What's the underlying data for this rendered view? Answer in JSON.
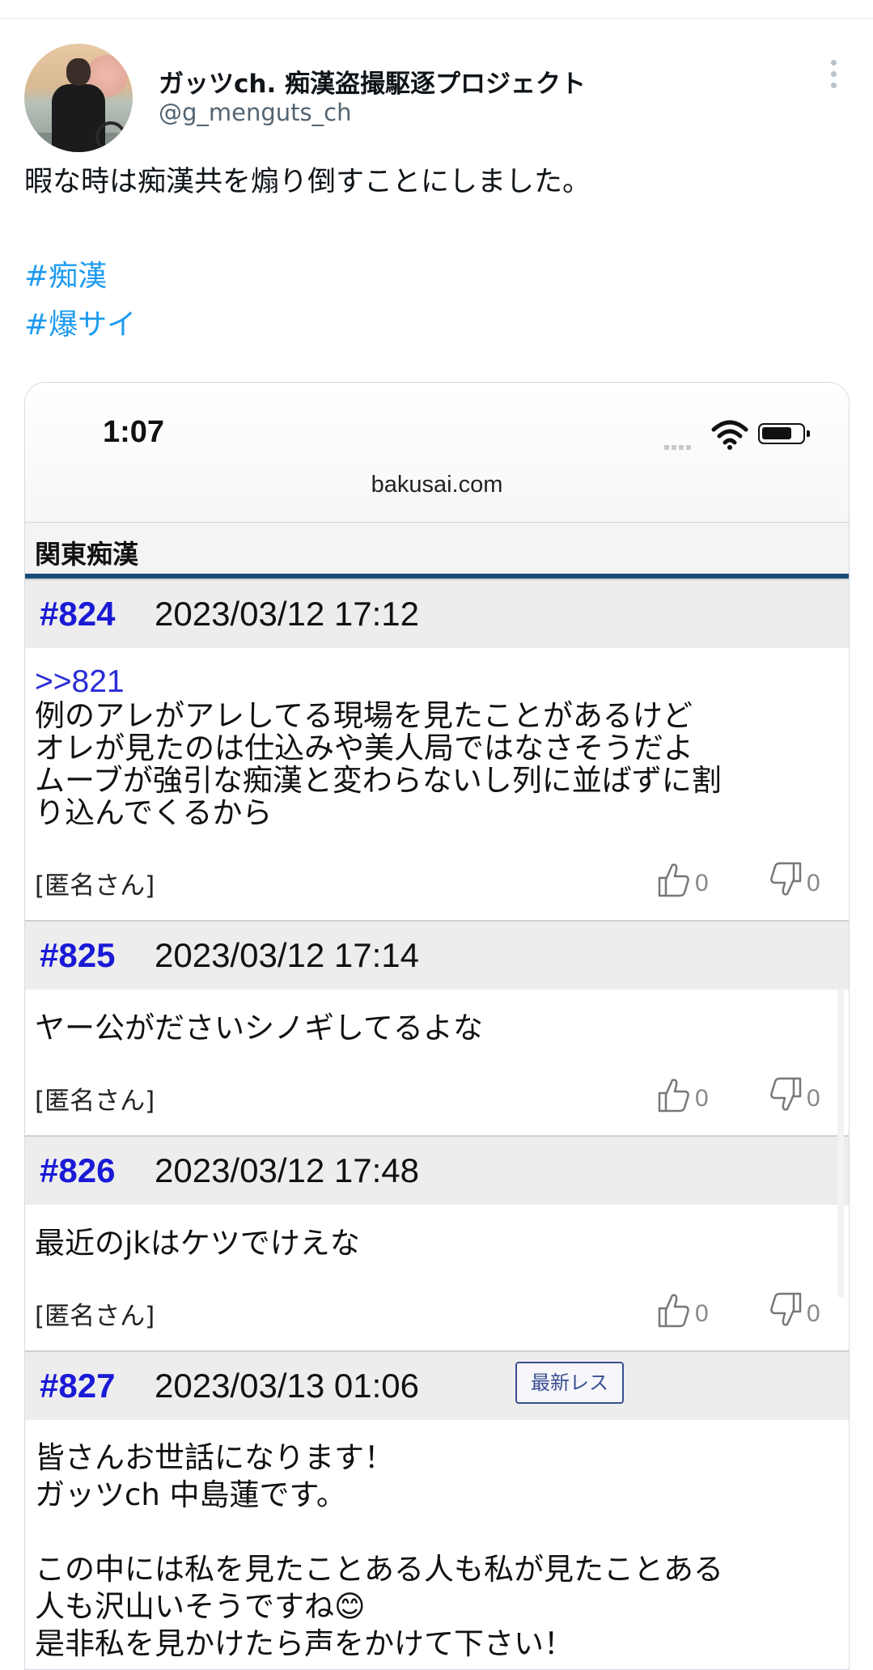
{
  "tweet": {
    "author_name": "ガッツch. 痴漢盗撮駆逐プロジェクト",
    "handle": "@g_menguts_ch",
    "text": "暇な時は痴漢共を煽り倒すことにしました。",
    "hashtags": [
      "#痴漢",
      "#爆サイ"
    ]
  },
  "embedded_screenshot": {
    "status_time": "1:07",
    "domain": "bakusai.com",
    "board_title": "関東痴漢",
    "posts": [
      {
        "number": "#824",
        "date": "2023/03/12 17:12",
        "reply_to": ">>821",
        "body": "例のアレがアレしてる現場を見たことがあるけど\nオレが見たのは仕込みや美人局ではなさそうだよ\nムーブが強引な痴漢と変わらないし列に並ばずに割\nり込んでくるから",
        "author": "[匿名さん]",
        "likes": "0",
        "dislikes": "0"
      },
      {
        "number": "#825",
        "date": "2023/03/12 17:14",
        "body": "ヤー公がださいシノギしてるよな",
        "author": "[匿名さん]",
        "likes": "0",
        "dislikes": "0"
      },
      {
        "number": "#826",
        "date": "2023/03/12 17:48",
        "body": "最近のjkはケツでけえな",
        "author": "[匿名さん]",
        "likes": "0",
        "dislikes": "0"
      },
      {
        "number": "#827",
        "date": "2023/03/13 01:06",
        "badge": "最新レス",
        "body": "皆さんお世話になります！\nガッツch 中島蓮です。\n\nこの中には私を見たことある人も私が見たことある\n人も沢山いそうですね😊\n是非私を見かけたら声をかけて下さい！"
      }
    ]
  },
  "icons": [
    "more-options-icon",
    "wifi-icon",
    "battery-icon",
    "thumbs-up-icon",
    "thumbs-down-icon"
  ],
  "colors": {
    "hashtag": "#1d9bf0",
    "post_number": "#1a1ad6",
    "board_rule": "#1b4d7a",
    "handle": "#536471"
  }
}
